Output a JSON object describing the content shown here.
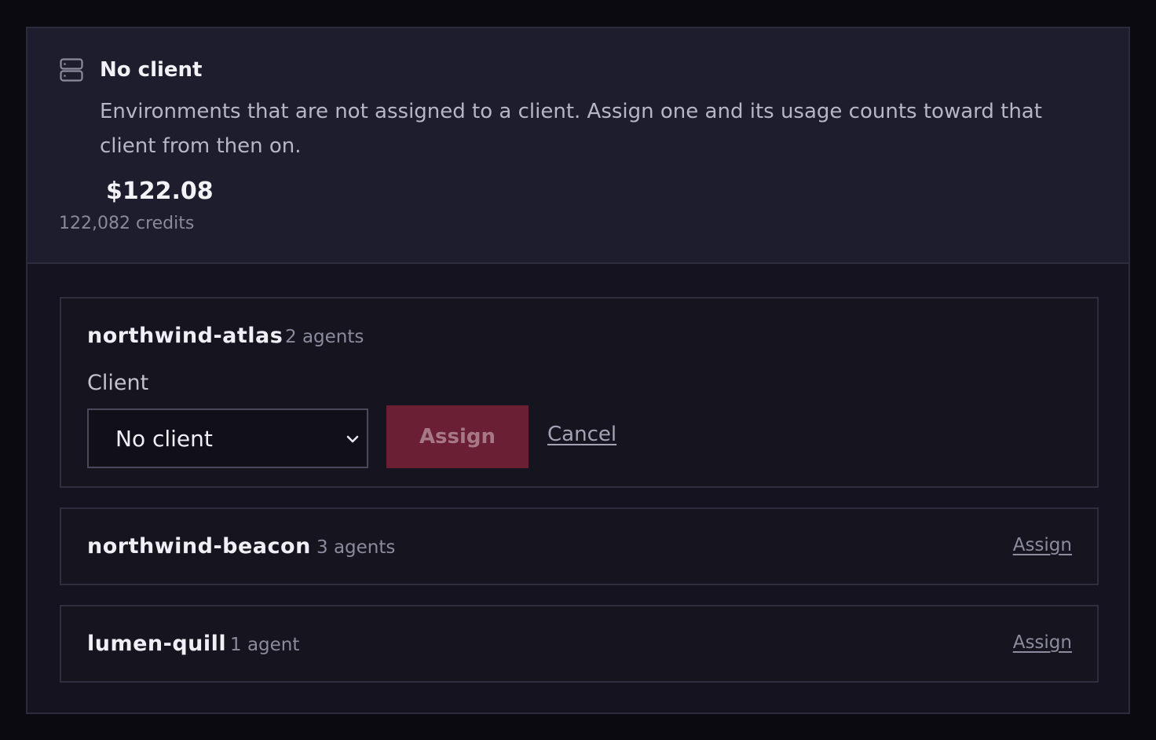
{
  "header": {
    "icon": "server-icon",
    "title": "No client",
    "description": "Environments that are not assigned to a client. Assign one and its usage counts toward that client from then on.",
    "amount": "$122.08",
    "credits": "122,082 credits"
  },
  "environments": [
    {
      "name": "northwind-atlas",
      "agents": "2 agents",
      "expanded": true,
      "client_label": "Client",
      "client_select": {
        "selected": "No client",
        "icon": "chevron-down-icon"
      },
      "assign_button": "Assign",
      "cancel_link": "Cancel"
    },
    {
      "name": "northwind-beacon",
      "agents": "3 agents",
      "assign_link": "Assign"
    },
    {
      "name": "lumen-quill",
      "agents": "1 agent",
      "assign_link": "Assign"
    }
  ],
  "colors": {
    "page_bg": "#0b0a11",
    "header_bg": "#1e1d2d",
    "card_bg": "#15141f",
    "assign_button_bg": "#6a1f34"
  }
}
